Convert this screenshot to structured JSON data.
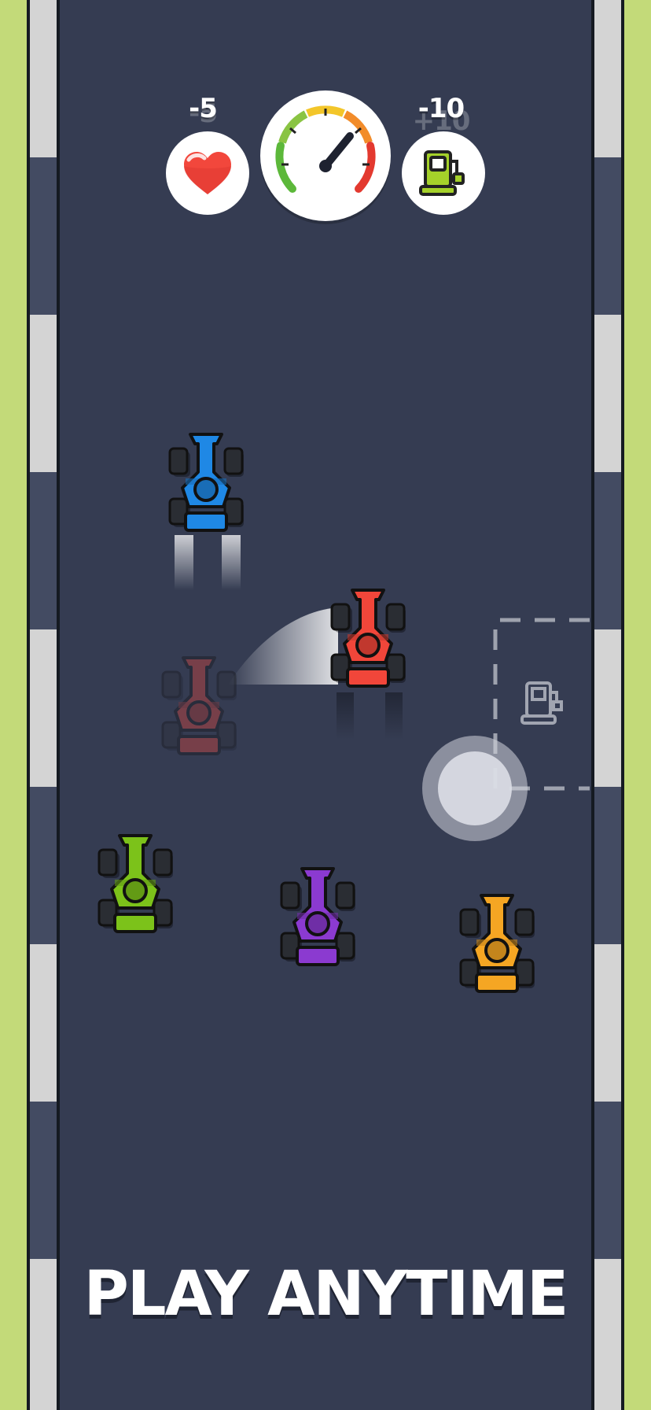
{
  "hud": {
    "health_delta": "-5",
    "health_ghost": "-5",
    "fuel_delta": "-10",
    "fuel_ghost": "+10"
  },
  "cars": [
    {
      "name": "car-blue",
      "color": "#1f88e5"
    },
    {
      "name": "car-red",
      "color": "#f1463a"
    },
    {
      "name": "car-red-ghost",
      "color": "#f1463a"
    },
    {
      "name": "car-green",
      "color": "#7cc21a"
    },
    {
      "name": "car-purple",
      "color": "#8b3ad0"
    },
    {
      "name": "car-orange",
      "color": "#f5a623"
    }
  ],
  "icons": {
    "health": "heart-icon",
    "speed": "speedometer-icon",
    "fuel": "fuel-pump-icon",
    "fuel_zone": "fuel-pump-icon"
  },
  "colors": {
    "grass": "#c3da79",
    "road": "#353c52",
    "curb_light": "#d4d4d4",
    "curb_dark": "#434b62"
  },
  "tagline": "PLAY ANYTIME"
}
